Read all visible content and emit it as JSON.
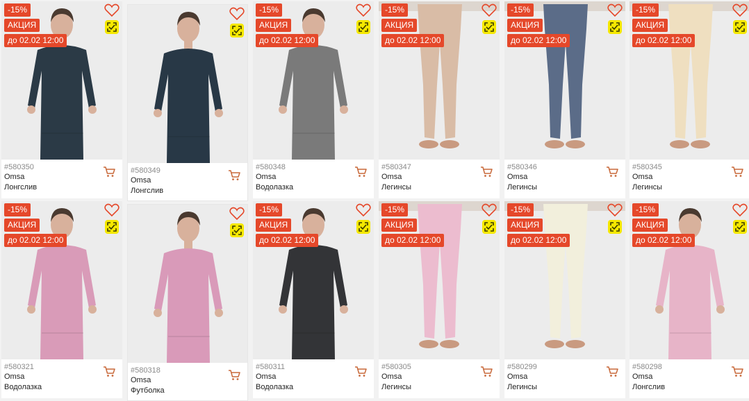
{
  "colors": {
    "accent": "#e5482a",
    "badge": "#f5e800",
    "cart": "#c8693a"
  },
  "icons": {
    "favorite": "heart-icon",
    "badge": "lightning-icon",
    "cart": "cart-icon"
  },
  "products": [
    {
      "sku": "#580350",
      "brand": "Omsa",
      "type": "Лонгслив",
      "discount": "-15%",
      "promo": "АКЦИЯ",
      "date": "до 02.02 12:00",
      "garment": "top",
      "color": "#2b3a46",
      "skin": "#d8b19c"
    },
    {
      "sku": "#580349",
      "brand": "Omsa",
      "type": "Лонгслив",
      "discount": "",
      "promo": "",
      "date": "",
      "garment": "top",
      "color": "#283846",
      "skin": "#d8b19c"
    },
    {
      "sku": "#580348",
      "brand": "Omsa",
      "type": "Водолазка",
      "discount": "-15%",
      "promo": "АКЦИЯ",
      "date": "до 02.02 12:00",
      "garment": "top",
      "color": "#7a7a7a",
      "skin": "#d8b19c"
    },
    {
      "sku": "#580347",
      "brand": "Omsa",
      "type": "Легинсы",
      "discount": "-15%",
      "promo": "АКЦИЯ",
      "date": "до 02.02 12:00",
      "garment": "legs",
      "color": "#d9bca6",
      "skin": "#c99a80"
    },
    {
      "sku": "#580346",
      "brand": "Omsa",
      "type": "Легинсы",
      "discount": "-15%",
      "promo": "АКЦИЯ",
      "date": "до 02.02 12:00",
      "garment": "legs",
      "color": "#5b6c88",
      "skin": "#c99a80"
    },
    {
      "sku": "#580345",
      "brand": "Omsa",
      "type": "Легинсы",
      "discount": "-15%",
      "promo": "АКЦИЯ",
      "date": "до 02.02 12:00",
      "garment": "legs",
      "color": "#efdfc0",
      "skin": "#c99a80"
    },
    {
      "sku": "#580321",
      "brand": "Omsa",
      "type": "Водолазка",
      "discount": "-15%",
      "promo": "АКЦИЯ",
      "date": "до 02.02 12:00",
      "garment": "top",
      "color": "#d99bb8",
      "skin": "#d8b19c"
    },
    {
      "sku": "#580318",
      "brand": "Omsa",
      "type": "Футболка",
      "discount": "",
      "promo": "",
      "date": "",
      "garment": "top",
      "color": "#d99ab9",
      "skin": "#d8b19c"
    },
    {
      "sku": "#580311",
      "brand": "Omsa",
      "type": "Водолазка",
      "discount": "-15%",
      "promo": "АКЦИЯ",
      "date": "до 02.02 12:00",
      "garment": "top",
      "color": "#333437",
      "skin": "#d8b19c"
    },
    {
      "sku": "#580305",
      "brand": "Omsa",
      "type": "Легинсы",
      "discount": "-15%",
      "promo": "АКЦИЯ",
      "date": "до 02.02 12:00",
      "garment": "legs",
      "color": "#ecbccf",
      "skin": "#c99a80"
    },
    {
      "sku": "#580299",
      "brand": "Omsa",
      "type": "Легинсы",
      "discount": "-15%",
      "promo": "АКЦИЯ",
      "date": "до 02.02 12:00",
      "garment": "legs",
      "color": "#f2efdc",
      "skin": "#c99a80"
    },
    {
      "sku": "#580298",
      "brand": "Omsa",
      "type": "Лонгслив",
      "discount": "-15%",
      "promo": "АКЦИЯ",
      "date": "до 02.02 12:00",
      "garment": "top",
      "color": "#e7b4c8",
      "skin": "#d8b19c"
    }
  ]
}
